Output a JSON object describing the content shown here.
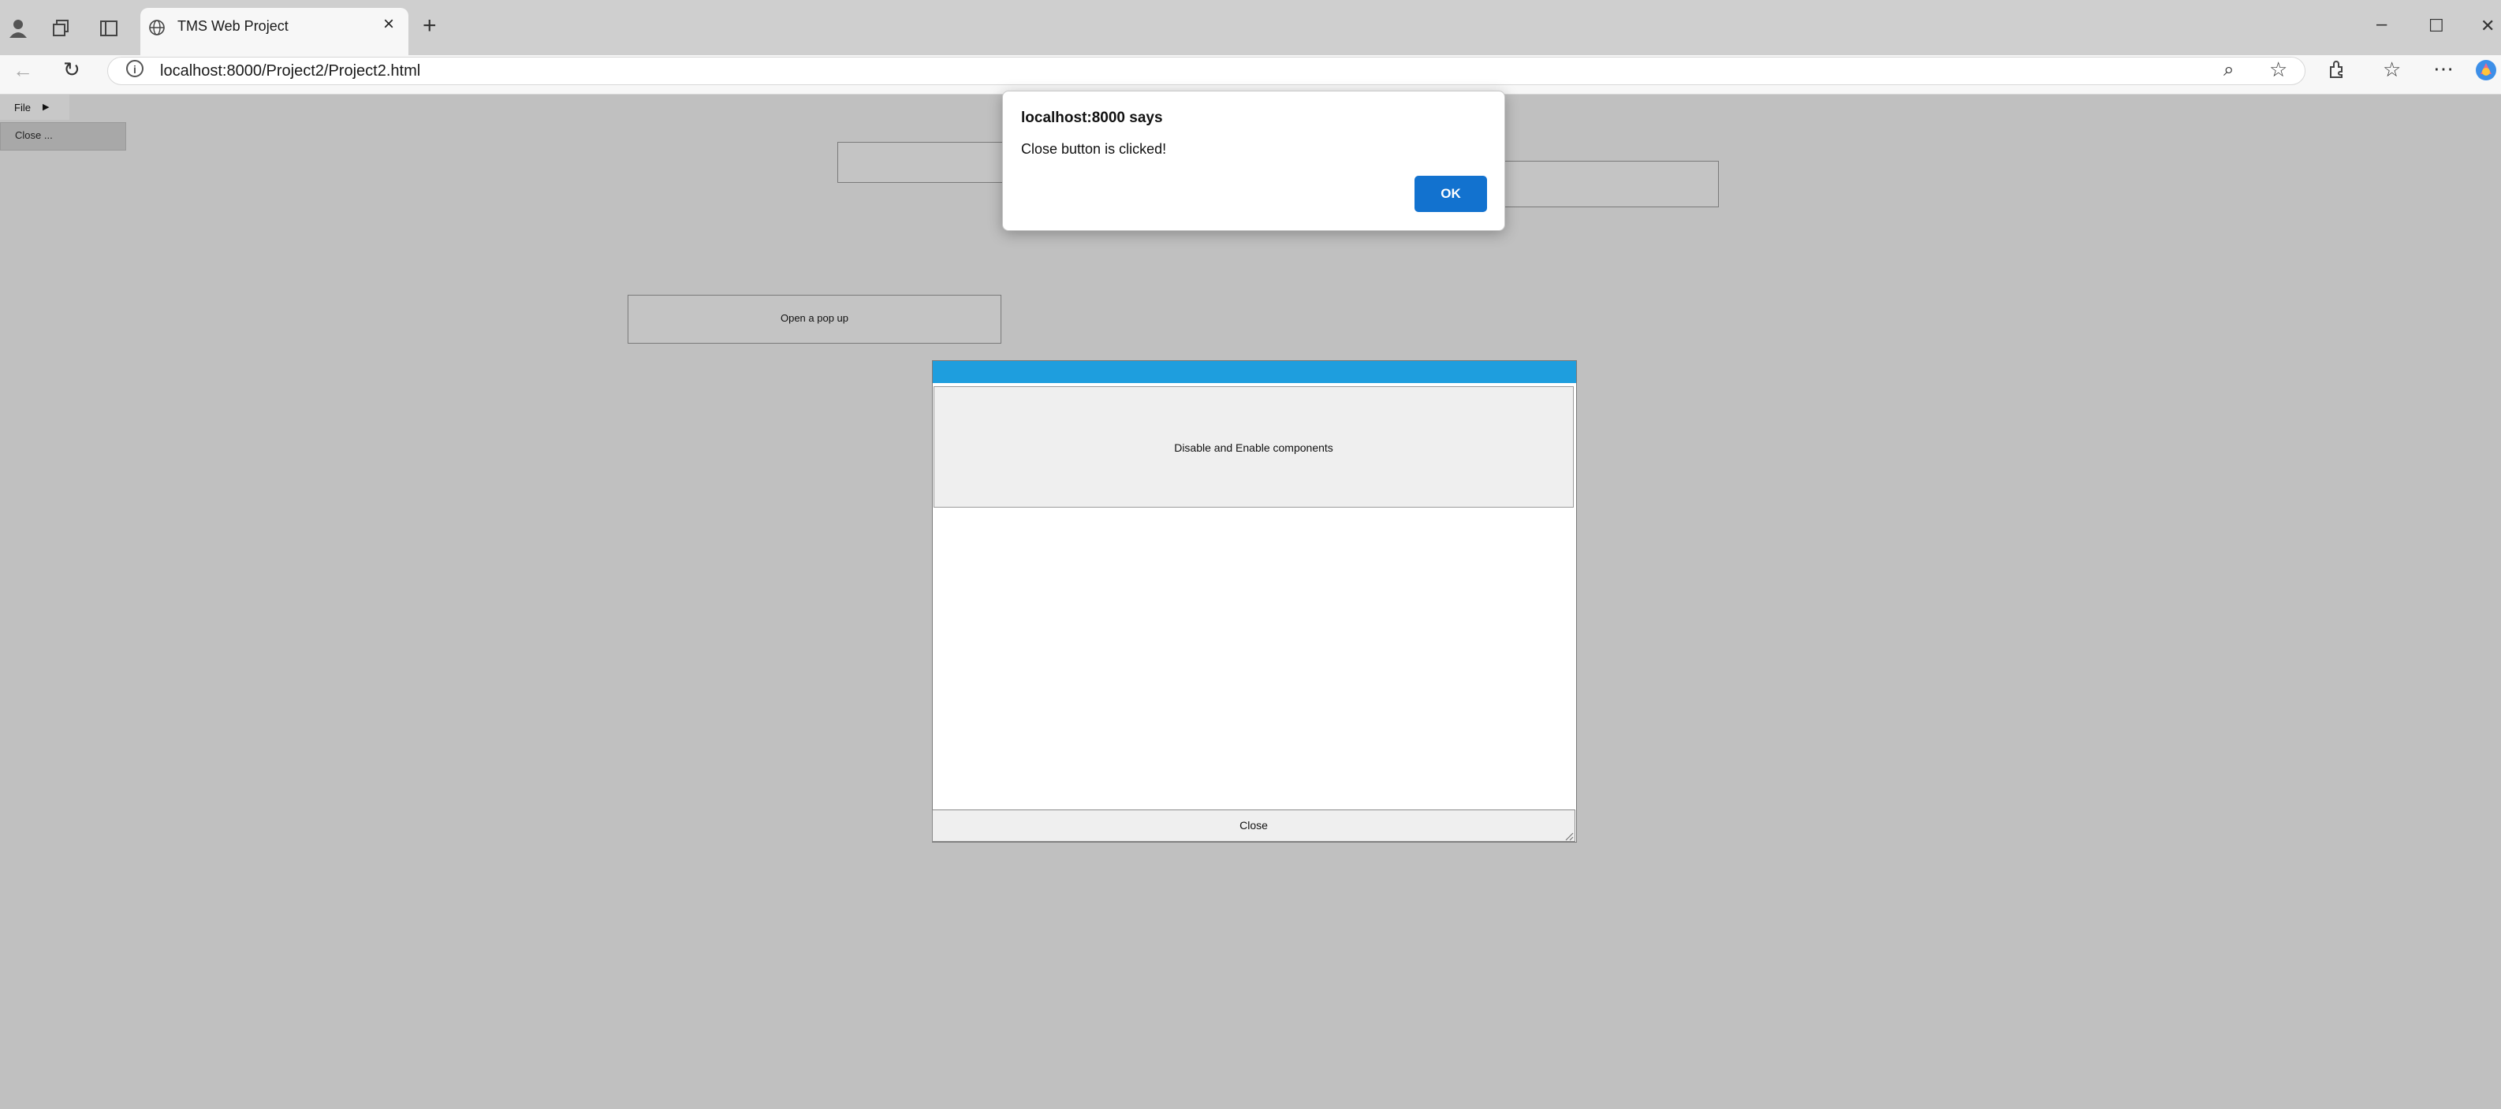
{
  "browser": {
    "tab_title": "TMS Web Project",
    "tab_close": "×",
    "new_tab": "+",
    "url": "localhost:8000/Project2/Project2.html",
    "address_info": "i",
    "window_controls": {
      "minimize": "–",
      "maximize": "☐",
      "close": "✕"
    },
    "icons": {
      "profile": "person-icon",
      "collections": "collections-icon",
      "tab_actions": "tab-actions-icon",
      "back": "←",
      "refresh": "↻",
      "zoom": "⌕",
      "favorite": "☆",
      "extensions": "extensions-icon",
      "favorites": "☆",
      "more": "⋯",
      "copilot": "copilot-icon",
      "globe": "globe-icon"
    }
  },
  "page": {
    "menu": {
      "file_label": "File",
      "file_arrow": "▶",
      "close_item": "Close ..."
    },
    "open_popup_button": "Open a pop up",
    "popup": {
      "caption": "",
      "disable_enable_button": "Disable and Enable components",
      "close_button": "Close",
      "caption_color": "#1e9ede"
    }
  },
  "alert": {
    "title": "localhost:8000 says",
    "message": "Close button is clicked!",
    "ok_label": "OK",
    "ok_color": "#1272cf"
  }
}
